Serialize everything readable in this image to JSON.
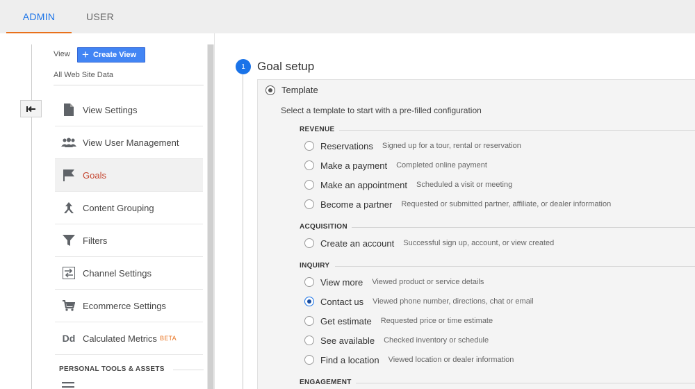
{
  "tabs": [
    {
      "label": "ADMIN",
      "active": true
    },
    {
      "label": "USER",
      "active": false
    }
  ],
  "left_panel": {
    "view_label": "View",
    "create_view_label": "Create View",
    "view_name": "All Web Site Data",
    "menu": [
      {
        "label": "View Settings",
        "icon": "document-icon",
        "active": false
      },
      {
        "label": "View User Management",
        "icon": "people-icon",
        "active": false
      },
      {
        "label": "Goals",
        "icon": "flag-icon",
        "active": true
      },
      {
        "label": "Content Grouping",
        "icon": "content-grouping-icon",
        "active": false
      },
      {
        "label": "Filters",
        "icon": "filter-icon",
        "active": false
      },
      {
        "label": "Channel Settings",
        "icon": "channel-settings-icon",
        "active": false
      },
      {
        "label": "Ecommerce Settings",
        "icon": "cart-icon",
        "active": false
      },
      {
        "label": "Calculated Metrics",
        "badge": "BETA",
        "icon": "dd-icon",
        "active": false
      }
    ],
    "section_title": "PERSONAL TOOLS & ASSETS"
  },
  "goal_setup": {
    "step_number": "1",
    "title": "Goal setup",
    "template_label": "Template",
    "template_description": "Select a template to start with a pre-filled configuration",
    "categories": [
      {
        "title": "REVENUE",
        "options": [
          {
            "name": "Reservations",
            "desc": "Signed up for a tour, rental or reservation",
            "selected": false
          },
          {
            "name": "Make a payment",
            "desc": "Completed online payment",
            "selected": false
          },
          {
            "name": "Make an appointment",
            "desc": "Scheduled a visit or meeting",
            "selected": false
          },
          {
            "name": "Become a partner",
            "desc": "Requested or submitted partner, affiliate, or dealer information",
            "selected": false
          }
        ]
      },
      {
        "title": "ACQUISITION",
        "options": [
          {
            "name": "Create an account",
            "desc": "Successful sign up, account, or view created",
            "selected": false
          }
        ]
      },
      {
        "title": "INQUIRY",
        "options": [
          {
            "name": "View more",
            "desc": "Viewed product or service details",
            "selected": false
          },
          {
            "name": "Contact us",
            "desc": "Viewed phone number, directions, chat or email",
            "selected": true
          },
          {
            "name": "Get estimate",
            "desc": "Requested price or time estimate",
            "selected": false
          },
          {
            "name": "See available",
            "desc": "Checked inventory or schedule",
            "selected": false
          },
          {
            "name": "Find a location",
            "desc": "Viewed location or dealer information",
            "selected": false
          }
        ]
      },
      {
        "title": "ENGAGEMENT",
        "options": []
      }
    ]
  },
  "colors": {
    "accent_blue": "#1a73e8",
    "active_orange": "#e8711c",
    "goals_red": "#c5452f"
  }
}
